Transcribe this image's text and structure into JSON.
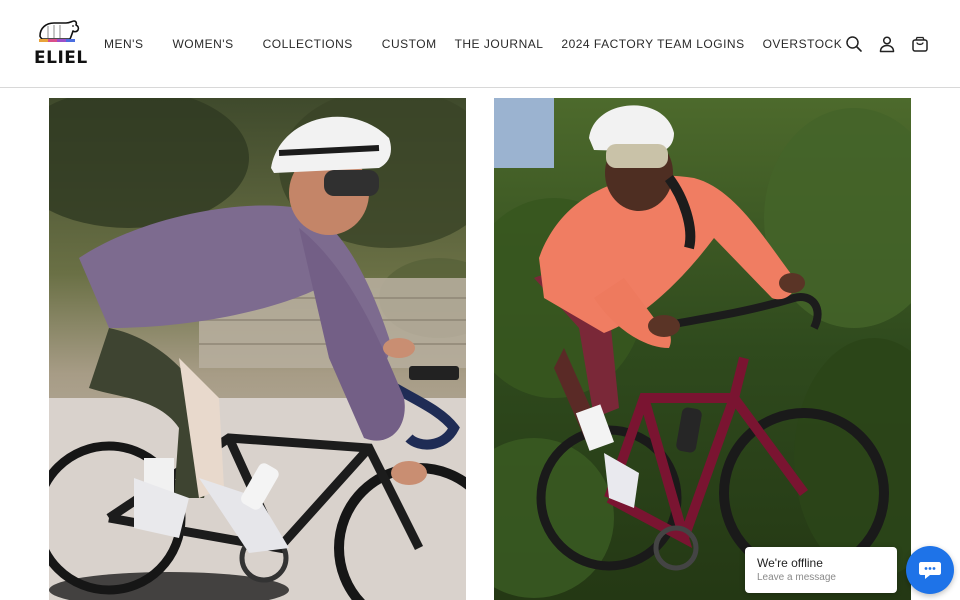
{
  "brand": {
    "logo_text": "ELIEL",
    "stripe_colors": [
      "#e8a33a",
      "#d94f8a",
      "#9b4fc9",
      "#4b6ee0"
    ]
  },
  "nav": {
    "items": [
      {
        "label": "MEN'S"
      },
      {
        "label": "WOMEN'S"
      },
      {
        "label": "COLLECTIONS"
      },
      {
        "label": "CUSTOM"
      },
      {
        "label": "THE JOURNAL"
      },
      {
        "label": "2024 FACTORY TEAM LOGINS"
      },
      {
        "label": "OVERSTOCK"
      }
    ]
  },
  "header_icons": [
    "search-icon",
    "account-icon",
    "cart-icon"
  ],
  "images": [
    {
      "name": "male-cyclist-purple-jersey"
    },
    {
      "name": "female-cyclist-coral-jersey"
    }
  ],
  "chat": {
    "title": "We're offline",
    "subtitle": "Leave a message",
    "accent": "#1e73e8"
  }
}
